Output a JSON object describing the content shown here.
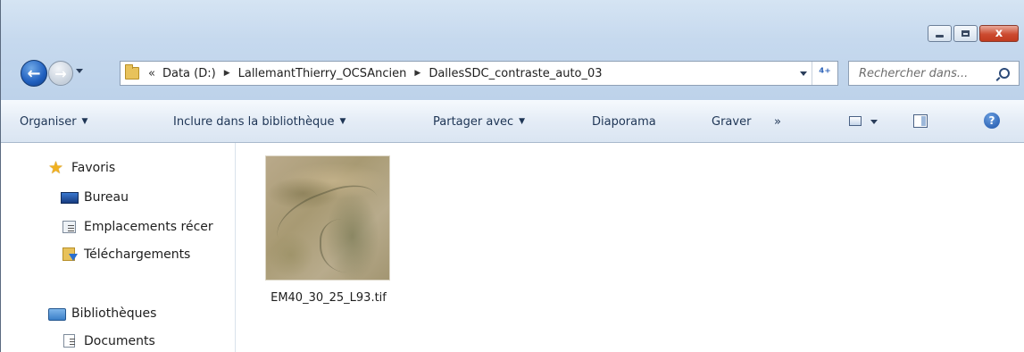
{
  "window": {
    "controls": {
      "minimize": "",
      "maximize": "",
      "close": "x"
    }
  },
  "nav": {
    "back_icon": "back-arrow-icon",
    "forward_icon": "forward-arrow-icon"
  },
  "address": {
    "chevron": "«",
    "crumbs": [
      "Data (D:)",
      "LallemantThierry_OCSAncien",
      "DallesSDC_contraste_auto_03"
    ],
    "separator": "▶",
    "refresh_glyph": "⁴⁺"
  },
  "search": {
    "placeholder": "Rechercher dans..."
  },
  "toolbar": {
    "organiser": "Organiser",
    "inclure": "Inclure dans la bibliothèque",
    "partager": "Partager avec",
    "diaporama": "Diaporama",
    "graver": "Graver",
    "more": "»",
    "dropdown_arrow": "▼",
    "help": "?"
  },
  "sidebar": {
    "favorites_title": "Favoris",
    "favorites": [
      "Bureau",
      "Emplacements récer",
      "Téléchargements"
    ],
    "libraries_title": "Bibliothèques",
    "libraries": [
      "Documents"
    ]
  },
  "files": [
    {
      "name": "EM40_30_25_L93.tif"
    }
  ]
}
